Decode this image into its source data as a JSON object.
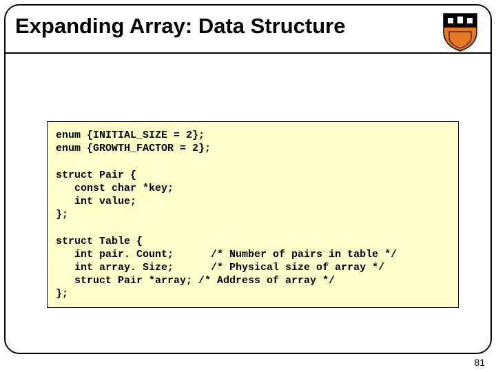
{
  "slide": {
    "title": "Expanding Array: Data Structure",
    "page_number": "81"
  },
  "code": {
    "line01": "enum {INITIAL_SIZE = 2};",
    "line02": "enum {GROWTH_FACTOR = 2};",
    "line03": "",
    "line04": "struct Pair {",
    "line05": "   const char *key;",
    "line06": "   int value;",
    "line07": "};",
    "line08": "",
    "line09": "struct Table {",
    "line10": "   int pair. Count;      /* Number of pairs in table */",
    "line11": "   int array. Size;      /* Physical size of array */",
    "line12": "   struct Pair *array; /* Address of array */",
    "line13": "};"
  }
}
